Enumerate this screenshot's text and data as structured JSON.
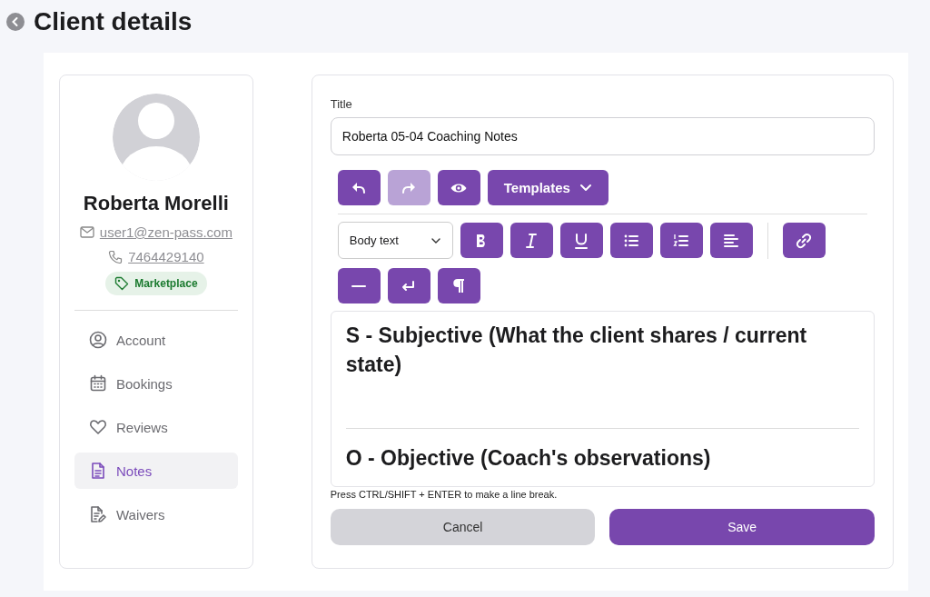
{
  "page": {
    "title": "Client details"
  },
  "client": {
    "name": "Roberta Morelli",
    "email": "user1@zen-pass.com",
    "phone": "7464429140",
    "tag": "Marketplace"
  },
  "nav": [
    {
      "label": "Account",
      "selected": false
    },
    {
      "label": "Bookings",
      "selected": false
    },
    {
      "label": "Reviews",
      "selected": false
    },
    {
      "label": "Notes",
      "selected": true
    },
    {
      "label": "Waivers",
      "selected": false
    }
  ],
  "form": {
    "title_label": "Title",
    "title_value": "Roberta 05-04 Coaching Notes",
    "history_buttons": [
      {
        "disabled": false
      },
      {
        "disabled": true
      },
      {
        "disabled": false
      }
    ],
    "templates_button": "Templates",
    "style_select": "Body text",
    "hint": "Press CTRL/SHIFT + ENTER to make a line break.",
    "cancel": "Cancel",
    "save": "Save"
  },
  "editor": [
    {
      "kind": "heading",
      "text": "S - Subjective (What the client shares / current state)"
    },
    {
      "kind": "blank"
    },
    {
      "kind": "rule"
    },
    {
      "kind": "heading",
      "text": "O - Objective (Coach's observations)"
    }
  ]
}
